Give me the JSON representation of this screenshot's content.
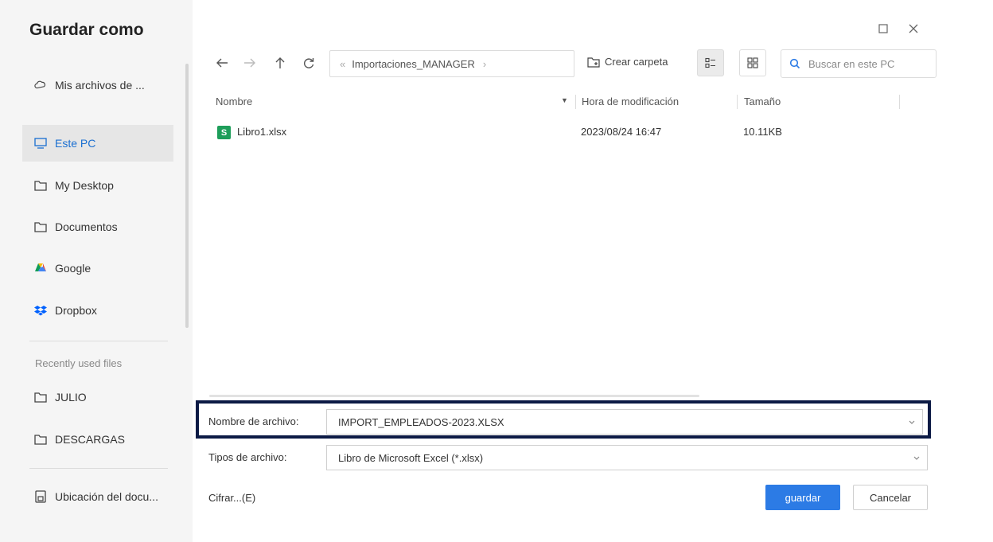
{
  "dialog": {
    "title": "Guardar como"
  },
  "sidebar": {
    "items": [
      {
        "label": "Mis archivos de ...",
        "icon": "cloud-icon"
      },
      {
        "label": "Este PC",
        "icon": "monitor-icon",
        "active": true
      },
      {
        "label": "My Desktop",
        "icon": "folder-icon"
      },
      {
        "label": "Documentos",
        "icon": "folder-icon"
      },
      {
        "label": "Google",
        "icon": "google-drive-icon"
      },
      {
        "label": "Dropbox",
        "icon": "dropbox-icon"
      }
    ],
    "recent_heading": "Recently used files",
    "recent": [
      {
        "label": "JULIO",
        "icon": "folder-icon"
      },
      {
        "label": "DESCARGAS",
        "icon": "folder-icon"
      }
    ],
    "location": {
      "label": "Ubicación del docu...",
      "icon": "document-location-icon"
    }
  },
  "toolbar": {
    "breadcrumb": "Importaciones_MANAGER",
    "new_folder": "Crear carpeta",
    "search_placeholder": "Buscar en este PC"
  },
  "file_list": {
    "columns": [
      "Nombre",
      "Hora de modificación",
      "Tamaño"
    ],
    "rows": [
      {
        "name": "Libro1.xlsx",
        "icon_letter": "S",
        "modified": "2023/08/24 16:47",
        "size": "10.11KB"
      }
    ]
  },
  "form": {
    "filename_label": "Nombre de archivo:",
    "filename_value": "IMPORT_EMPLEADOS-2023.XLSX",
    "filetype_label": "Tipos de archivo:",
    "filetype_value": "Libro de Microsoft Excel (*.xlsx)",
    "cipher_label": "Cifrar...(E)"
  },
  "buttons": {
    "save": "guardar",
    "cancel": "Cancelar"
  },
  "colors": {
    "accent": "#2c7be5",
    "highlight_border": "#0c1a45",
    "xlsx_green": "#1e9e5a"
  }
}
